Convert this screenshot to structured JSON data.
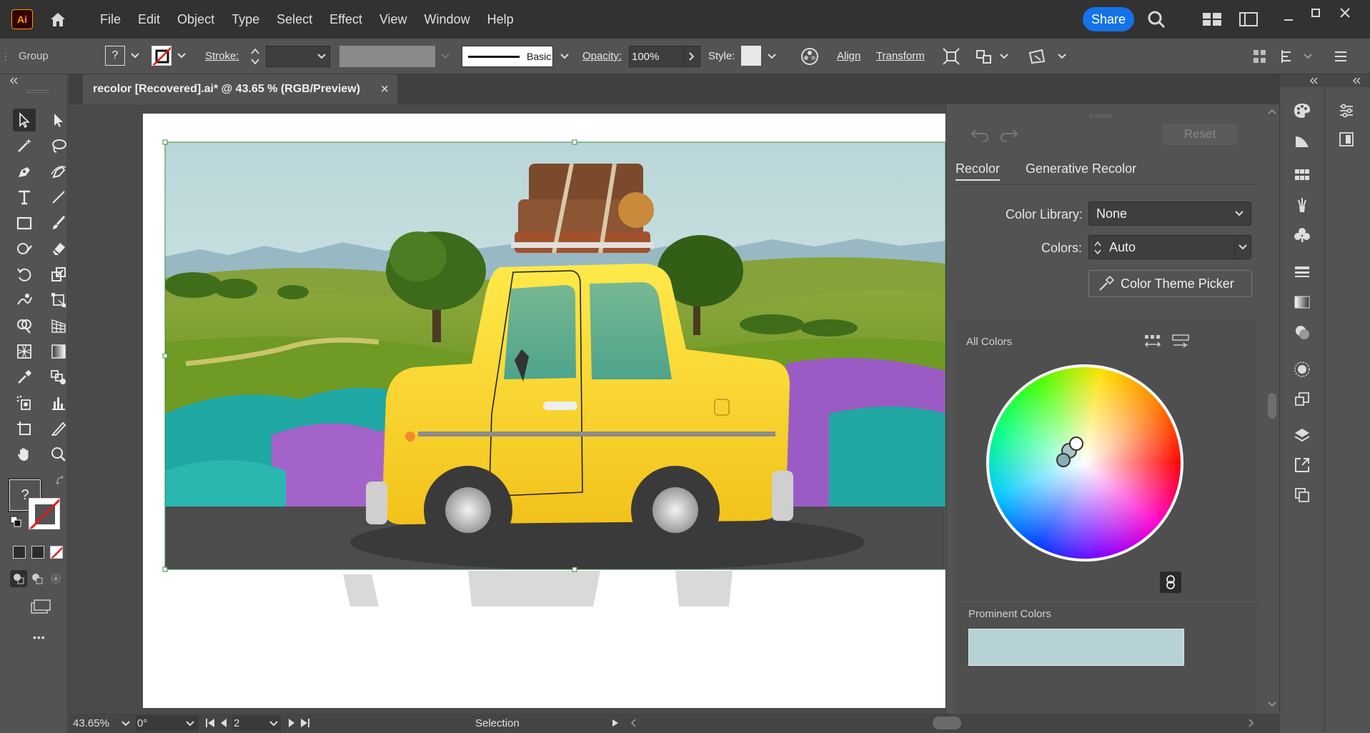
{
  "app": {
    "logo": "Ai"
  },
  "menu": [
    "File",
    "Edit",
    "Object",
    "Type",
    "Select",
    "Effect",
    "View",
    "Window",
    "Help"
  ],
  "header": {
    "share_label": "Share"
  },
  "control_bar": {
    "selection_type": "Group",
    "fill_value": "?",
    "stroke_label": "Stroke:",
    "brush_label": "Basic",
    "opacity_label": "Opacity:",
    "opacity_value": "100%",
    "style_label": "Style:",
    "align_label": "Align",
    "transform_label": "Transform"
  },
  "document": {
    "tab_title": "recolor [Recovered].ai* @ 43.65 % (RGB/Preview)",
    "close_glyph": "×"
  },
  "tools": {
    "fill_question": "?",
    "more": "•••"
  },
  "recolor_panel": {
    "reset_label": "Reset",
    "tabs": [
      "Recolor",
      "Generative Recolor"
    ],
    "color_library_label": "Color Library:",
    "color_library_value": "None",
    "colors_label": "Colors:",
    "colors_value": "Auto",
    "theme_picker_label": "Color Theme Picker",
    "all_colors_label": "All Colors",
    "prominent_colors_label": "Prominent Colors",
    "prominent_swatch": "#b7d2d6"
  },
  "status_bar": {
    "zoom": "43.65%",
    "rotation": "0°",
    "artboard": "2",
    "tool": "Selection"
  },
  "colors": {
    "accent": "#1473e6",
    "ui_bg": "#535353",
    "menubar": "#323232",
    "taxi_yellow": "#f7d51d"
  }
}
